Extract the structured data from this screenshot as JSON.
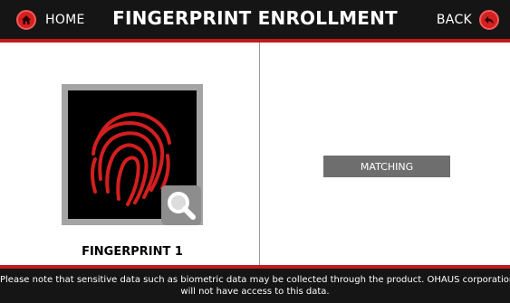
{
  "header": {
    "home_label": "HOME",
    "title": "FINGERPRINT ENROLLMENT",
    "back_label": "BACK"
  },
  "icons": {
    "home": "home-icon",
    "back": "back-arrow-icon",
    "fingerprint": "fingerprint-icon",
    "magnifier": "magnifier-icon"
  },
  "fingerprint": {
    "caption": "FINGERPRINT 1"
  },
  "status": {
    "label": "MATCHING"
  },
  "footer": {
    "line1": "Please note that sensitive data such as biometric data may be collected through the product. OHAUS corporation",
    "line2": "will not have access to this data."
  },
  "colors": {
    "accent": "#c51a1a",
    "header_bg": "#151515",
    "status_bg": "#6e6e6e"
  }
}
